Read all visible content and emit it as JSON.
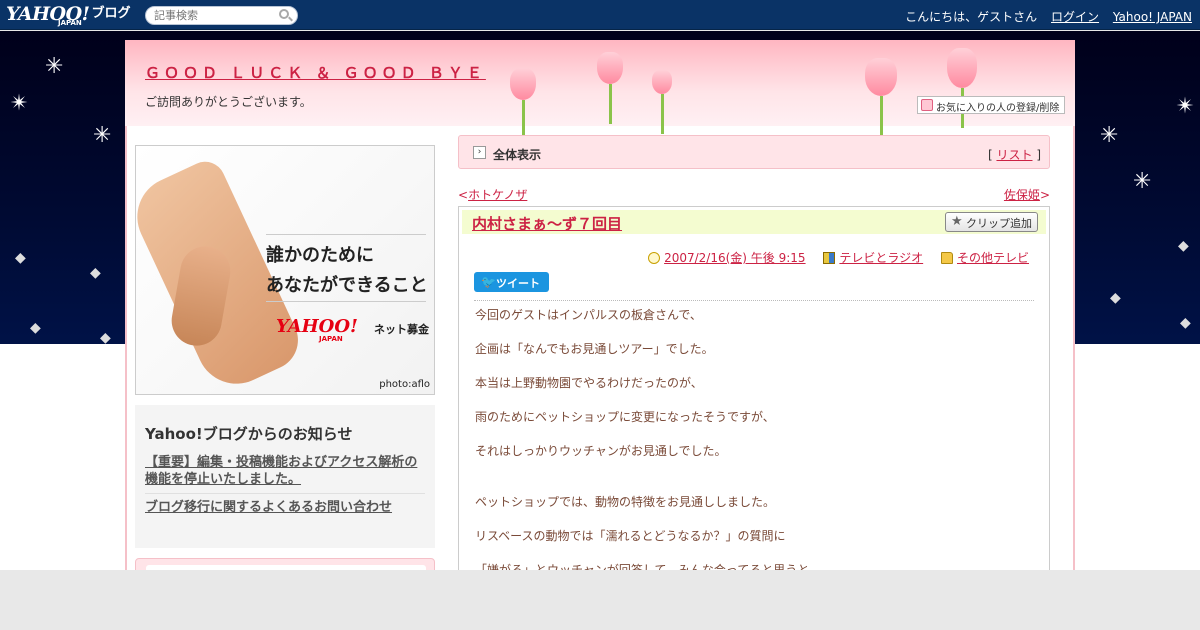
{
  "topbar": {
    "logo_brand": "YAHOO!",
    "logo_sub": "JAPAN",
    "logo_blog": "ブログ",
    "search_placeholder": "記事検索",
    "greeting": "こんにちは、ゲストさん",
    "login": "ログイン",
    "yahoo_japan": "Yahoo! JAPAN"
  },
  "header": {
    "blog_title": "ＧＯＯＤ ＬＵＣＫ ＆ ＧＯＯＤ ＢＹＥ",
    "blog_desc": "ご訪問ありがとうございます。",
    "favorite_button": "お気に入りの人の登録/削除"
  },
  "banner": {
    "line1": "誰かのために",
    "line2": "あなたができること",
    "logo_brand": "YAHOO!",
    "logo_sub": "JAPAN",
    "net": "ネット募金",
    "photo_credit": "photo:aflo"
  },
  "notice": {
    "title": "Yahoo!ブログからのお知らせ",
    "links": [
      "【重要】編集・投稿機能およびアクセス解析の機能を停止いたしました。",
      "ブログ移行に関するよくあるお問い合わせ"
    ]
  },
  "allbar": {
    "label": "全体表示",
    "list_open": "[",
    "list_label": "リスト",
    "list_close": "]"
  },
  "nav": {
    "prev_arrow": "<",
    "prev_label": "ホトケノザ",
    "next_label": "佐保姫",
    "next_arrow": ">"
  },
  "article": {
    "title": "内村さまぁ～ず７回目",
    "clip_button": "クリップ追加",
    "date": "2007/2/16(金) 午後 9:15",
    "category1": "テレビとラジオ",
    "category2": "その他テレビ",
    "tweet": "ツイート",
    "paragraphs": [
      "今回のゲストはインパルスの板倉さんで、",
      "企画は「なんでもお見通しツアー」でした。",
      "本当は上野動物園でやるわけだったのが、",
      "雨のためにペットショップに変更になったそうですが、",
      "それはしっかりウッチャンがお見通しでした。",
      "ペットショップでは、動物の特徴をお見通ししました。",
      "リスベースの動物では「濡れるとどうなるか？」の質問に",
      "「嫌がる」とウッチャンが回答して、みんな合ってると思うと"
    ]
  },
  "colors": {
    "topbar": "#0a3366",
    "accent": "#cc2244",
    "header_pink": "#ffb6c1",
    "title_bar": "#f4fcd0",
    "tweet": "#1b95e0"
  }
}
